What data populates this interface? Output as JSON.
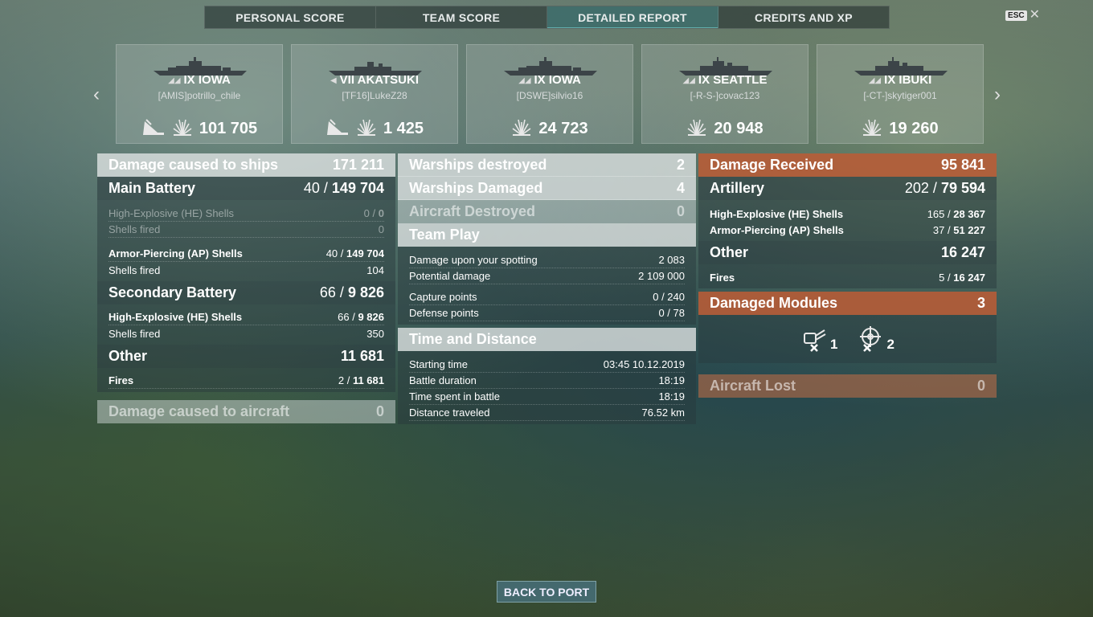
{
  "tabs": [
    "PERSONAL SCORE",
    "TEAM SCORE",
    "DETAILED REPORT",
    "CREDITS AND XP"
  ],
  "esc_label": "ESC",
  "close_symbol": "✕",
  "arrows": {
    "prev": "‹",
    "next": "›"
  },
  "ships": [
    {
      "name": "IX IOWA",
      "player": "[AMIS]potrillo_chile",
      "damage": "101 705",
      "class": "battleship",
      "flag": true
    },
    {
      "name": "VII AKATSUKI",
      "player": "[TF16]LukeZ28",
      "damage": "1 425",
      "class": "destroyer",
      "flag": true
    },
    {
      "name": "IX IOWA",
      "player": "[DSWE]silvio16",
      "damage": "24 723",
      "class": "battleship",
      "flag": false
    },
    {
      "name": "IX SEATTLE",
      "player": "[-R-S-]covac123",
      "damage": "20 948",
      "class": "cruiser",
      "flag": false
    },
    {
      "name": "IX IBUKI",
      "player": "[-CT-]skytiger001",
      "damage": "19 260",
      "class": "cruiser",
      "flag": false
    }
  ],
  "left": {
    "damage_ships": {
      "label": "Damage caused to ships",
      "value": "171 211"
    },
    "main_battery": {
      "label": "Main Battery",
      "hits": "40 /",
      "value": "149 704"
    },
    "he1": {
      "label": "High-Explosive (HE) Shells",
      "hits": "0 /",
      "value": "0"
    },
    "he1_fired": {
      "label": "Shells fired",
      "value": "0"
    },
    "ap1": {
      "label": "Armor-Piercing (AP) Shells",
      "hits": "40 /",
      "value": "149 704"
    },
    "ap1_fired": {
      "label": "Shells fired",
      "value": "104"
    },
    "secondary": {
      "label": "Secondary Battery",
      "hits": "66 /",
      "value": "9 826"
    },
    "he2": {
      "label": "High-Explosive (HE) Shells",
      "hits": "66 /",
      "value": "9 826"
    },
    "he2_fired": {
      "label": "Shells fired",
      "value": "350"
    },
    "other": {
      "label": "Other",
      "value": "11 681"
    },
    "fires": {
      "label": "Fires",
      "hits": "2 /",
      "value": "11 681"
    },
    "aircraft": {
      "label": "Damage caused to aircraft",
      "value": "0"
    }
  },
  "middle": {
    "destroyed": {
      "label": "Warships destroyed",
      "value": "2"
    },
    "damaged": {
      "label": "Warships Damaged",
      "value": "4"
    },
    "aircraft_destroyed": {
      "label": "Aircraft Destroyed",
      "value": "0"
    },
    "team_play": "Team Play",
    "spotting": {
      "label": "Damage upon your spotting",
      "value": "2 083"
    },
    "potential": {
      "label": "Potential damage",
      "value": "2 109 000"
    },
    "capture": {
      "label": "Capture points",
      "value": "0 / 240"
    },
    "defense": {
      "label": "Defense points",
      "value": "0 / 78"
    },
    "time_distance": "Time and Distance",
    "start": {
      "label": "Starting time",
      "value": "03:45  10.12.2019"
    },
    "duration": {
      "label": "Battle duration",
      "value": "18:19"
    },
    "spent": {
      "label": "Time spent in battle",
      "value": "18:19"
    },
    "distance": {
      "label": "Distance traveled",
      "value": "76.52 km"
    }
  },
  "right": {
    "received": {
      "label": "Damage Received",
      "value": "95 841"
    },
    "artillery": {
      "label": "Artillery",
      "hits": "202 /",
      "value": "79 594"
    },
    "he": {
      "label": "High-Explosive (HE) Shells",
      "hits": "165 /",
      "value": "28 367"
    },
    "ap": {
      "label": "Armor-Piercing (AP) Shells",
      "hits": "37 /",
      "value": "51 227"
    },
    "other": {
      "label": "Other",
      "value": "16 247"
    },
    "fires": {
      "label": "Fires",
      "hits": "5 /",
      "value": "16 247"
    },
    "modules": {
      "label": "Damaged Modules",
      "value": "3"
    },
    "module_counts": [
      "1",
      "2"
    ],
    "aircraft_lost": {
      "label": "Aircraft Lost",
      "value": "0"
    }
  },
  "back_button": "BACK TO PORT"
}
